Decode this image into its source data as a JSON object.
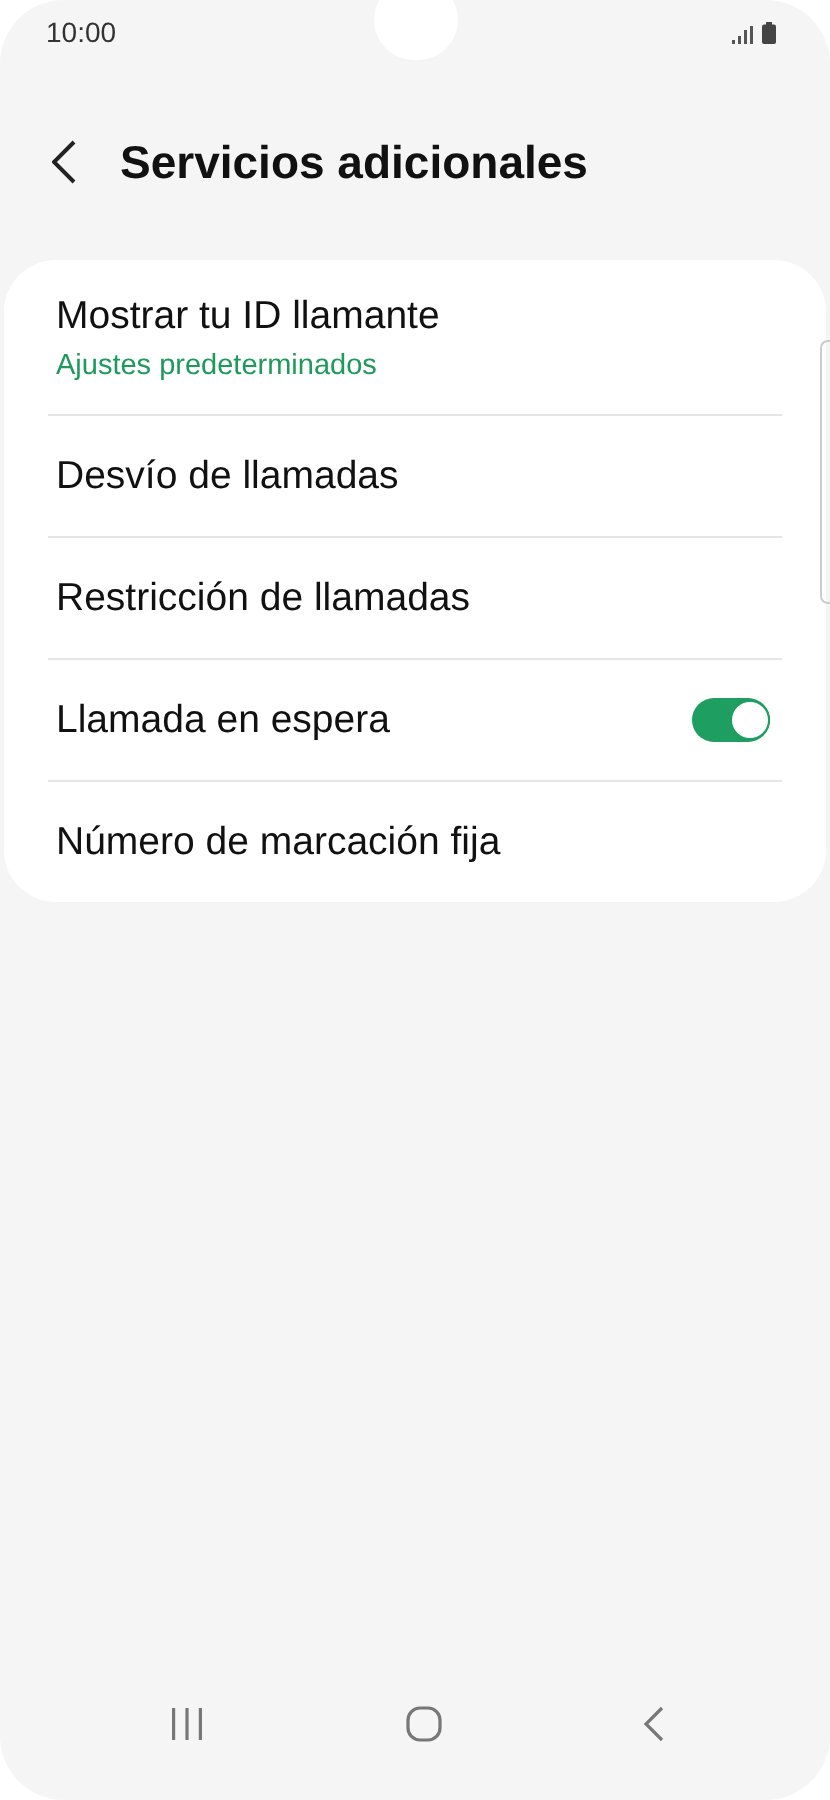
{
  "status_bar": {
    "time": "10:00"
  },
  "header": {
    "title": "Servicios adicionales"
  },
  "items": [
    {
      "kind": "text",
      "label": "Mostrar tu ID llamante",
      "subtitle": "Ajustes predeterminados"
    },
    {
      "kind": "text",
      "label": "Desvío de llamadas"
    },
    {
      "kind": "text",
      "label": "Restricción de llamadas"
    },
    {
      "kind": "toggle",
      "label": "Llamada en espera",
      "on": true
    },
    {
      "kind": "text",
      "label": "Número de marcación fija"
    }
  ]
}
